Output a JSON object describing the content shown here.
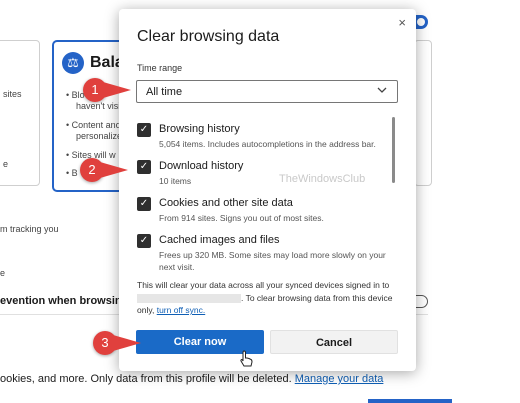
{
  "background": {
    "left_card_lines": [
      "sites",
      "e"
    ],
    "balanced": {
      "title": "Bala",
      "lines": [
        "Blo",
        "haven't visi",
        "Content and",
        "personalize",
        "Sites will w",
        "B"
      ]
    },
    "tracking_text": "m tracking you",
    "tracking_short": "e",
    "prevention_text": "evention when browsing I",
    "footer_text": "ookies, and more. Only data from this profile will be deleted.",
    "footer_link": "Manage your data"
  },
  "dialog": {
    "title": "Clear browsing data",
    "close_glyph": "×",
    "time_range_label": "Time range",
    "time_range_value": "All time",
    "options": [
      {
        "title": "Browsing history",
        "desc": "5,054 items. Includes autocompletions in the address bar.",
        "checked": true
      },
      {
        "title": "Download history",
        "desc": "10 items",
        "checked": true
      },
      {
        "title": "Cookies and other site data",
        "desc": "From 914 sites. Signs you out of most sites.",
        "checked": true
      },
      {
        "title": "Cached images and files",
        "desc": "Frees up 320 MB. Some sites may load more slowly on your next visit.",
        "checked": true
      }
    ],
    "watermark": "TheWindowsClub",
    "note_prefix": "This will clear your data across all your synced devices signed in to",
    "note_suffix": ". To clear browsing data from this device only,",
    "note_link": "turn off sync.",
    "clear_button": "Clear now",
    "cancel_button": "Cancel"
  },
  "markers": [
    "1",
    "2",
    "3"
  ],
  "colors": {
    "accent": "#1a6ac7",
    "marker": "#e0403d"
  }
}
